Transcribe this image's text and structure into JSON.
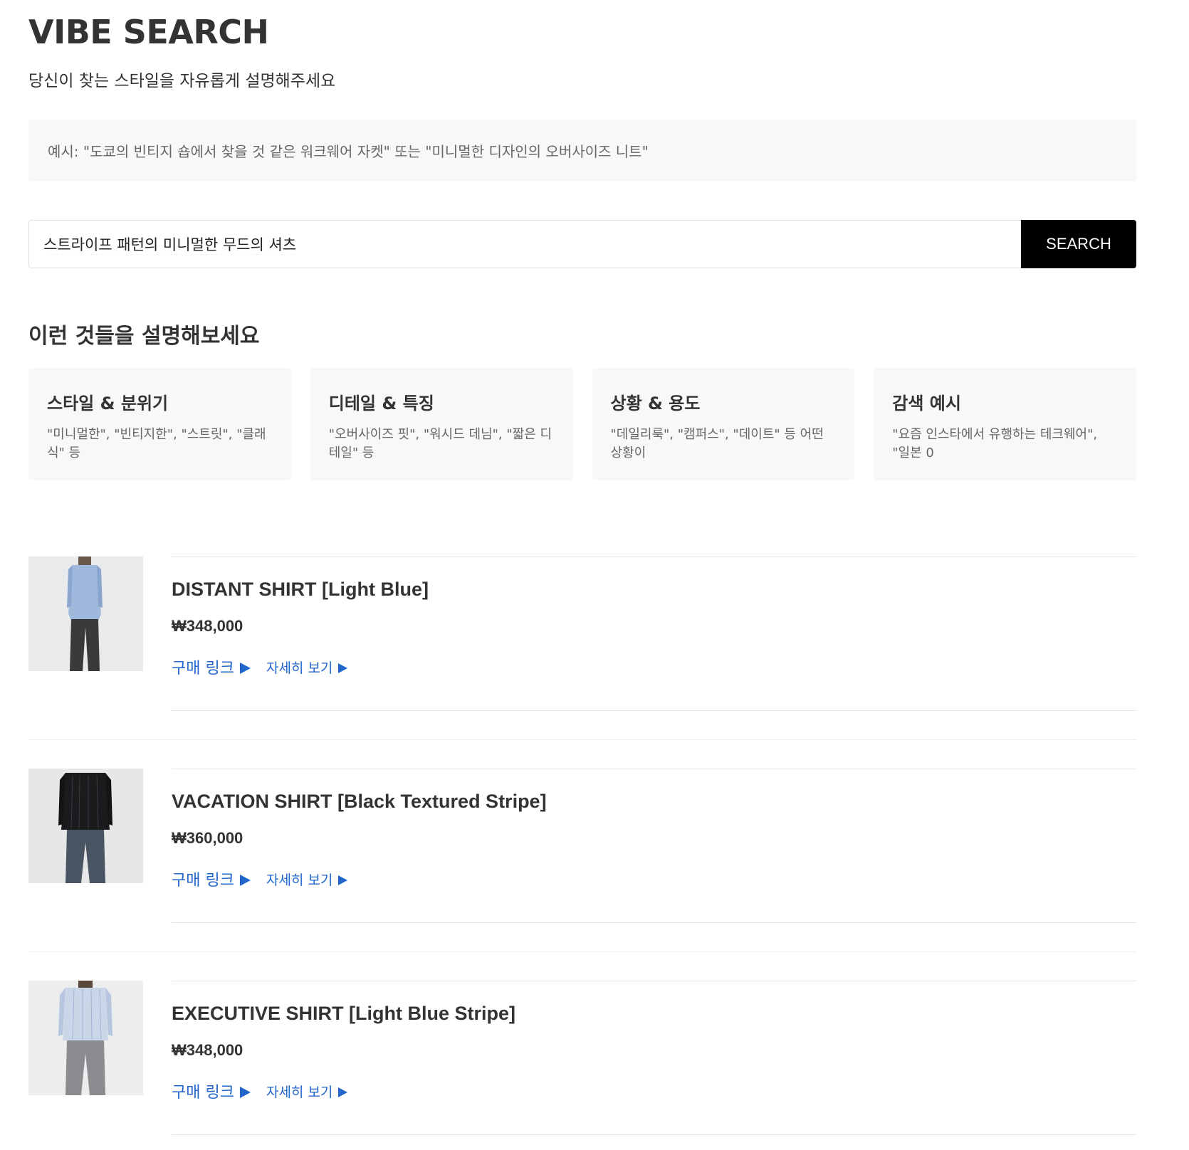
{
  "header": {
    "title": "VIBE SEARCH",
    "subtitle": "당신이 찾는 스타일을 자유롭게 설명해주세요"
  },
  "example": {
    "text": "예시: \"도쿄의 빈티지 숍에서 찾을 것 같은 워크웨어 자켓\" 또는 \"미니멀한 디자인의 오버사이즈 니트\""
  },
  "search": {
    "value": "스트라이프 패턴의 미니멀한 무드의 셔츠",
    "button_label": "SEARCH"
  },
  "tips": {
    "heading": "이런 것들을 설명해보세요",
    "cards": [
      {
        "title": "스타일 & 분위기",
        "desc": "\"미니멀한\", \"빈티지한\", \"스트릿\", \"클래식\" 등"
      },
      {
        "title": "디테일 & 특징",
        "desc": "\"오버사이즈 핏\", \"워시드 데님\", \"짧은 디테일\" 등"
      },
      {
        "title": "상황 & 용도",
        "desc": "\"데일리룩\", \"캠퍼스\", \"데이트\" 등 어떤 상황이"
      },
      {
        "title": "감색 예시",
        "desc": "\"요즘 인스타에서 유행하는 테크웨어\", \"일본 0"
      }
    ]
  },
  "results": [
    {
      "name": "DISTANT SHIRT [Light Blue]",
      "price": "₩348,000",
      "buy_label": "구매 링크",
      "detail_label": "자세히 보기",
      "colors": {
        "shirt": "#9fb8dc",
        "pants": "#3a3a3a",
        "bg": "#e9eaeb"
      }
    },
    {
      "name": "VACATION SHIRT [Black Textured Stripe]",
      "price": "₩360,000",
      "buy_label": "구매 링크",
      "detail_label": "자세히 보기",
      "colors": {
        "shirt": "#1b1b1e",
        "pants": "#4a5563",
        "bg": "#e6e7e7"
      }
    },
    {
      "name": "EXECUTIVE SHIRT [Light Blue Stripe]",
      "price": "₩348,000",
      "buy_label": "구매 링크",
      "detail_label": "자세히 보기",
      "colors": {
        "shirt": "#c9d6e8",
        "pants": "#8a8c90",
        "bg": "#eceded"
      }
    }
  ],
  "colors": {
    "link": "#2266cc",
    "button_bg": "#000000",
    "panel_bg": "#f8f8f8"
  }
}
